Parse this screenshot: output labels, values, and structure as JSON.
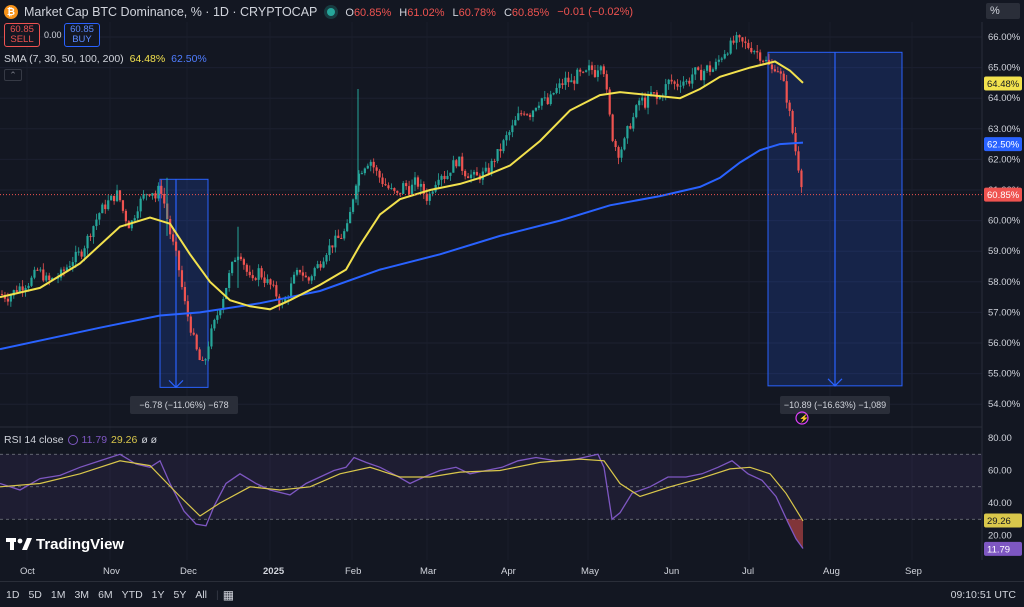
{
  "header": {
    "title": "Market Cap BTC Dominance, % · 1D · CRYPTOCAP",
    "open_k": "O",
    "open_v": "60.85%",
    "high_k": "H",
    "high_v": "61.02%",
    "low_k": "L",
    "low_v": "60.78%",
    "close_k": "C",
    "close_v": "60.85%",
    "change": "−0.01 (−0.02%)",
    "scale_label": "%"
  },
  "trade": {
    "sell_price": "60.85",
    "sell_label": "SELL",
    "spread": "0.00",
    "buy_price": "60.85",
    "buy_label": "BUY"
  },
  "sma": {
    "label": "SMA (7, 30, 50, 100, 200)",
    "v1": "64.48%",
    "v2": "62.50%"
  },
  "rsi": {
    "label": "RSI 14 close",
    "v1": "11.79",
    "v2": "29.26",
    "v3": "ø ø"
  },
  "brand": {
    "name": "TradingView"
  },
  "bottom": {
    "ranges": [
      "1D",
      "5D",
      "1M",
      "3M",
      "6M",
      "YTD",
      "1Y",
      "5Y",
      "All"
    ],
    "clock": "09:10:51 UTC"
  },
  "colors": {
    "background": "#131722",
    "up": "#26a69a",
    "down": "#ef5350",
    "sma_fast": "#f2e14d",
    "sma_slow": "#2962ff",
    "rsi": "#7e57c2",
    "rsi_ma": "#d9c74b"
  },
  "chart_data": [
    {
      "type": "candlestick",
      "x_tick_labels": [
        "Oct",
        "Nov",
        "Dec",
        "2025",
        "Feb",
        "Mar",
        "Apr",
        "May",
        "Jun",
        "Jul",
        "Aug",
        "Sep"
      ],
      "y_tick_labels": [
        "66.00%",
        "65.00%",
        "64.00%",
        "63.00%",
        "62.00%",
        "61.00%",
        "60.00%",
        "59.00%",
        "58.00%",
        "57.00%",
        "56.00%",
        "55.00%",
        "54.00%"
      ],
      "ylim": [
        53.6,
        66.3
      ],
      "last_close": 60.85,
      "ohlc_path": [
        [
          0,
          57.6
        ],
        [
          8,
          57.5
        ],
        [
          18,
          57.8
        ],
        [
          30,
          58.0
        ],
        [
          38,
          58.4
        ],
        [
          48,
          58.0
        ],
        [
          60,
          58.2
        ],
        [
          72,
          58.7
        ],
        [
          82,
          59.0
        ],
        [
          90,
          59.6
        ],
        [
          100,
          60.3
        ],
        [
          108,
          60.6
        ],
        [
          118,
          60.9
        ],
        [
          124,
          60.2
        ],
        [
          130,
          59.8
        ],
        [
          138,
          60.5
        ],
        [
          146,
          60.9
        ],
        [
          152,
          61.0
        ],
        [
          156,
          60.7
        ],
        [
          160,
          61.2
        ],
        [
          164,
          60.6
        ],
        [
          170,
          59.6
        ],
        [
          178,
          58.6
        ],
        [
          184,
          57.4
        ],
        [
          190,
          56.6
        ],
        [
          196,
          55.8
        ],
        [
          200,
          55.4
        ],
        [
          204,
          55.2
        ],
        [
          207,
          55.8
        ],
        [
          212,
          56.4
        ],
        [
          218,
          57.0
        ],
        [
          224,
          57.6
        ],
        [
          230,
          58.3
        ],
        [
          236,
          58.9
        ],
        [
          240,
          59.0
        ],
        [
          246,
          58.4
        ],
        [
          252,
          57.9
        ],
        [
          258,
          58.4
        ],
        [
          264,
          58.1
        ],
        [
          270,
          57.9
        ],
        [
          276,
          57.6
        ],
        [
          282,
          57.2
        ],
        [
          288,
          57.6
        ],
        [
          294,
          58.1
        ],
        [
          300,
          58.4
        ],
        [
          308,
          58.0
        ],
        [
          314,
          58.4
        ],
        [
          320,
          58.6
        ],
        [
          326,
          59.0
        ],
        [
          334,
          59.3
        ],
        [
          342,
          59.5
        ],
        [
          348,
          59.8
        ],
        [
          352,
          60.6
        ],
        [
          356,
          61.3
        ],
        [
          360,
          61.6
        ],
        [
          364,
          61.8
        ],
        [
          370,
          62.0
        ],
        [
          376,
          61.6
        ],
        [
          382,
          61.3
        ],
        [
          390,
          61.0
        ],
        [
          398,
          60.8
        ],
        [
          404,
          61.2
        ],
        [
          410,
          61.0
        ],
        [
          416,
          61.3
        ],
        [
          422,
          61.0
        ],
        [
          428,
          60.7
        ],
        [
          434,
          61.2
        ],
        [
          440,
          61.6
        ],
        [
          446,
          61.4
        ],
        [
          452,
          61.8
        ],
        [
          458,
          62.0
        ],
        [
          464,
          61.6
        ],
        [
          470,
          61.5
        ],
        [
          476,
          61.4
        ],
        [
          482,
          61.5
        ],
        [
          488,
          61.6
        ],
        [
          494,
          62.0
        ],
        [
          500,
          62.3
        ],
        [
          506,
          62.7
        ],
        [
          512,
          63.0
        ],
        [
          518,
          63.4
        ],
        [
          524,
          63.6
        ],
        [
          530,
          63.5
        ],
        [
          536,
          63.8
        ],
        [
          542,
          64.0
        ],
        [
          548,
          63.8
        ],
        [
          554,
          64.2
        ],
        [
          560,
          64.4
        ],
        [
          566,
          64.6
        ],
        [
          572,
          64.5
        ],
        [
          578,
          64.8
        ],
        [
          584,
          64.7
        ],
        [
          590,
          65.0
        ],
        [
          596,
          64.8
        ],
        [
          600,
          65.3
        ],
        [
          604,
          64.9
        ],
        [
          608,
          63.8
        ],
        [
          612,
          62.8
        ],
        [
          618,
          62.2
        ],
        [
          624,
          62.5
        ],
        [
          628,
          63.0
        ],
        [
          634,
          63.4
        ],
        [
          640,
          64.0
        ],
        [
          646,
          63.8
        ],
        [
          652,
          64.2
        ],
        [
          658,
          63.9
        ],
        [
          664,
          64.3
        ],
        [
          670,
          64.6
        ],
        [
          676,
          64.4
        ],
        [
          682,
          64.6
        ],
        [
          688,
          64.5
        ],
        [
          694,
          64.9
        ],
        [
          700,
          64.7
        ],
        [
          706,
          65.0
        ],
        [
          712,
          64.9
        ],
        [
          718,
          65.2
        ],
        [
          724,
          65.5
        ],
        [
          730,
          65.7
        ],
        [
          736,
          65.9
        ],
        [
          742,
          65.8
        ],
        [
          748,
          65.7
        ],
        [
          754,
          65.6
        ],
        [
          760,
          65.4
        ],
        [
          766,
          65.2
        ],
        [
          772,
          64.9
        ],
        [
          776,
          65.1
        ],
        [
          780,
          64.8
        ],
        [
          784,
          64.4
        ],
        [
          788,
          63.8
        ],
        [
          792,
          63.0
        ],
        [
          796,
          62.2
        ],
        [
          800,
          61.5
        ],
        [
          804,
          60.85
        ]
      ]
    },
    {
      "type": "line",
      "name": "SMA",
      "series": [
        {
          "name": "fast",
          "last": 64.48,
          "points": [
            [
              0,
              57.5
            ],
            [
              40,
              57.8
            ],
            [
              80,
              58.6
            ],
            [
              120,
              59.8
            ],
            [
              150,
              60.1
            ],
            [
              170,
              59.9
            ],
            [
              190,
              58.9
            ],
            [
              210,
              58.0
            ],
            [
              230,
              57.4
            ],
            [
              250,
              57.2
            ],
            [
              270,
              57.1
            ],
            [
              290,
              57.4
            ],
            [
              320,
              57.9
            ],
            [
              346,
              58.4
            ],
            [
              360,
              59.2
            ],
            [
              380,
              60.2
            ],
            [
              400,
              60.7
            ],
            [
              430,
              61.0
            ],
            [
              460,
              61.2
            ],
            [
              480,
              61.4
            ],
            [
              510,
              61.8
            ],
            [
              540,
              62.6
            ],
            [
              570,
              63.6
            ],
            [
              600,
              64.1
            ],
            [
              620,
              64.2
            ],
            [
              650,
              64.1
            ],
            [
              680,
              64.0
            ],
            [
              700,
              64.3
            ],
            [
              720,
              64.7
            ],
            [
              750,
              65.0
            ],
            [
              775,
              65.2
            ],
            [
              790,
              64.9
            ],
            [
              803,
              64.5
            ]
          ]
        },
        {
          "name": "slow",
          "last": 62.5,
          "points": [
            [
              0,
              55.8
            ],
            [
              100,
              56.5
            ],
            [
              160,
              56.9
            ],
            [
              200,
              57.0
            ],
            [
              260,
              57.3
            ],
            [
              320,
              57.7
            ],
            [
              380,
              58.4
            ],
            [
              440,
              58.9
            ],
            [
              500,
              59.5
            ],
            [
              560,
              60.0
            ],
            [
              610,
              60.5
            ],
            [
              660,
              60.8
            ],
            [
              700,
              61.1
            ],
            [
              720,
              61.4
            ],
            [
              740,
              61.9
            ],
            [
              760,
              62.3
            ],
            [
              780,
              62.5
            ],
            [
              803,
              62.55
            ]
          ]
        }
      ]
    },
    {
      "type": "annotation",
      "name": "measures",
      "items": [
        {
          "label": "−6.78 (−11.06%) −678",
          "from": 61.35,
          "to": 54.55
        },
        {
          "label": "−10.89 (−16.63%) −1,089",
          "from": 65.5,
          "to": 54.6
        }
      ]
    },
    {
      "type": "line",
      "name": "RSI",
      "y_tick_labels": [
        "80.00",
        "60.00",
        "40.00",
        "20.00"
      ],
      "ylim": [
        10,
        80
      ],
      "levels": [
        70,
        50,
        30
      ],
      "last_rsi": 11.79,
      "last_ma": 29.26,
      "rsi": [
        [
          0,
          52
        ],
        [
          20,
          48
        ],
        [
          40,
          55
        ],
        [
          60,
          57
        ],
        [
          80,
          62
        ],
        [
          100,
          66
        ],
        [
          120,
          70
        ],
        [
          136,
          64
        ],
        [
          150,
          62
        ],
        [
          160,
          66
        ],
        [
          170,
          52
        ],
        [
          184,
          35
        ],
        [
          196,
          27
        ],
        [
          206,
          26
        ],
        [
          214,
          38
        ],
        [
          226,
          52
        ],
        [
          240,
          58
        ],
        [
          256,
          52
        ],
        [
          270,
          48
        ],
        [
          290,
          45
        ],
        [
          306,
          52
        ],
        [
          320,
          56
        ],
        [
          334,
          60
        ],
        [
          346,
          62
        ],
        [
          354,
          68
        ],
        [
          366,
          65
        ],
        [
          380,
          62
        ],
        [
          396,
          57
        ],
        [
          410,
          52
        ],
        [
          424,
          56
        ],
        [
          440,
          60
        ],
        [
          456,
          62
        ],
        [
          470,
          58
        ],
        [
          486,
          60
        ],
        [
          502,
          62
        ],
        [
          518,
          66
        ],
        [
          536,
          68
        ],
        [
          556,
          66
        ],
        [
          576,
          67
        ],
        [
          598,
          70
        ],
        [
          604,
          62
        ],
        [
          612,
          30
        ],
        [
          620,
          34
        ],
        [
          632,
          46
        ],
        [
          650,
          50
        ],
        [
          668,
          56
        ],
        [
          686,
          56
        ],
        [
          702,
          58
        ],
        [
          718,
          62
        ],
        [
          732,
          66
        ],
        [
          748,
          58
        ],
        [
          762,
          54
        ],
        [
          776,
          44
        ],
        [
          788,
          28
        ],
        [
          796,
          18
        ],
        [
          803,
          12
        ]
      ],
      "rsi_ma": [
        [
          0,
          50
        ],
        [
          40,
          52
        ],
        [
          80,
          58
        ],
        [
          120,
          66
        ],
        [
          150,
          63
        ],
        [
          180,
          44
        ],
        [
          200,
          32
        ],
        [
          220,
          40
        ],
        [
          250,
          50
        ],
        [
          280,
          48
        ],
        [
          310,
          50
        ],
        [
          340,
          58
        ],
        [
          370,
          62
        ],
        [
          400,
          56
        ],
        [
          430,
          56
        ],
        [
          460,
          59
        ],
        [
          500,
          60
        ],
        [
          540,
          65
        ],
        [
          580,
          67
        ],
        [
          604,
          66
        ],
        [
          620,
          52
        ],
        [
          640,
          44
        ],
        [
          670,
          50
        ],
        [
          700,
          55
        ],
        [
          730,
          61
        ],
        [
          750,
          62
        ],
        [
          770,
          58
        ],
        [
          786,
          46
        ],
        [
          803,
          29
        ]
      ]
    }
  ]
}
